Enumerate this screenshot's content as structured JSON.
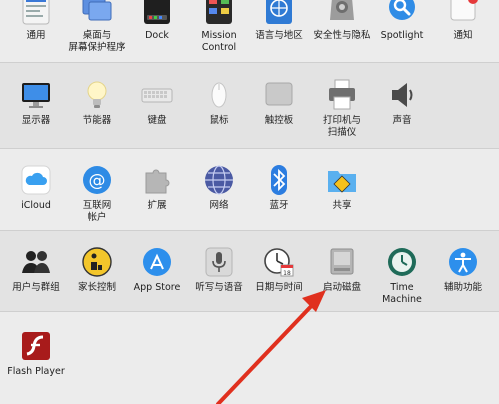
{
  "rows": {
    "personal": [
      {
        "label": "通用",
        "icon": "general-icon"
      },
      {
        "label": "桌面与\n屏幕保护程序",
        "icon": "desktop-icon"
      },
      {
        "label": "Dock",
        "icon": "dock-icon"
      },
      {
        "label": "Mission\nControl",
        "icon": "mission-control-icon"
      },
      {
        "label": "语言与地区",
        "icon": "language-region-icon"
      },
      {
        "label": "安全性与隐私",
        "icon": "security-icon"
      },
      {
        "label": "Spotlight",
        "icon": "spotlight-icon"
      },
      {
        "label": "通知",
        "icon": "notifications-icon"
      }
    ],
    "hardware": [
      {
        "label": "显示器",
        "icon": "display-icon"
      },
      {
        "label": "节能器",
        "icon": "energy-saver-icon"
      },
      {
        "label": "键盘",
        "icon": "keyboard-icon"
      },
      {
        "label": "鼠标",
        "icon": "mouse-icon"
      },
      {
        "label": "触控板",
        "icon": "trackpad-icon"
      },
      {
        "label": "打印机与\n扫描仪",
        "icon": "printer-icon"
      },
      {
        "label": "声音",
        "icon": "sound-icon"
      }
    ],
    "internet": [
      {
        "label": "iCloud",
        "icon": "icloud-icon"
      },
      {
        "label": "互联网\n帐户",
        "icon": "internet-accounts-icon"
      },
      {
        "label": "扩展",
        "icon": "extensions-icon"
      },
      {
        "label": "网络",
        "icon": "network-icon"
      },
      {
        "label": "蓝牙",
        "icon": "bluetooth-icon"
      },
      {
        "label": "共享",
        "icon": "sharing-icon"
      }
    ],
    "system": [
      {
        "label": "用户与群组",
        "icon": "users-groups-icon"
      },
      {
        "label": "家长控制",
        "icon": "parental-controls-icon"
      },
      {
        "label": "App Store",
        "icon": "app-store-icon"
      },
      {
        "label": "听写与语音",
        "icon": "dictation-icon"
      },
      {
        "label": "日期与时间",
        "icon": "date-time-icon"
      },
      {
        "label": "启动磁盘",
        "icon": "startup-disk-icon"
      },
      {
        "label": "Time Machine",
        "icon": "time-machine-icon"
      },
      {
        "label": "辅助功能",
        "icon": "accessibility-icon"
      }
    ],
    "other": [
      {
        "label": "Flash Player",
        "icon": "flash-player-icon"
      }
    ]
  },
  "date_icon_text": "18",
  "annotation_arrow_color": "#e0301e"
}
